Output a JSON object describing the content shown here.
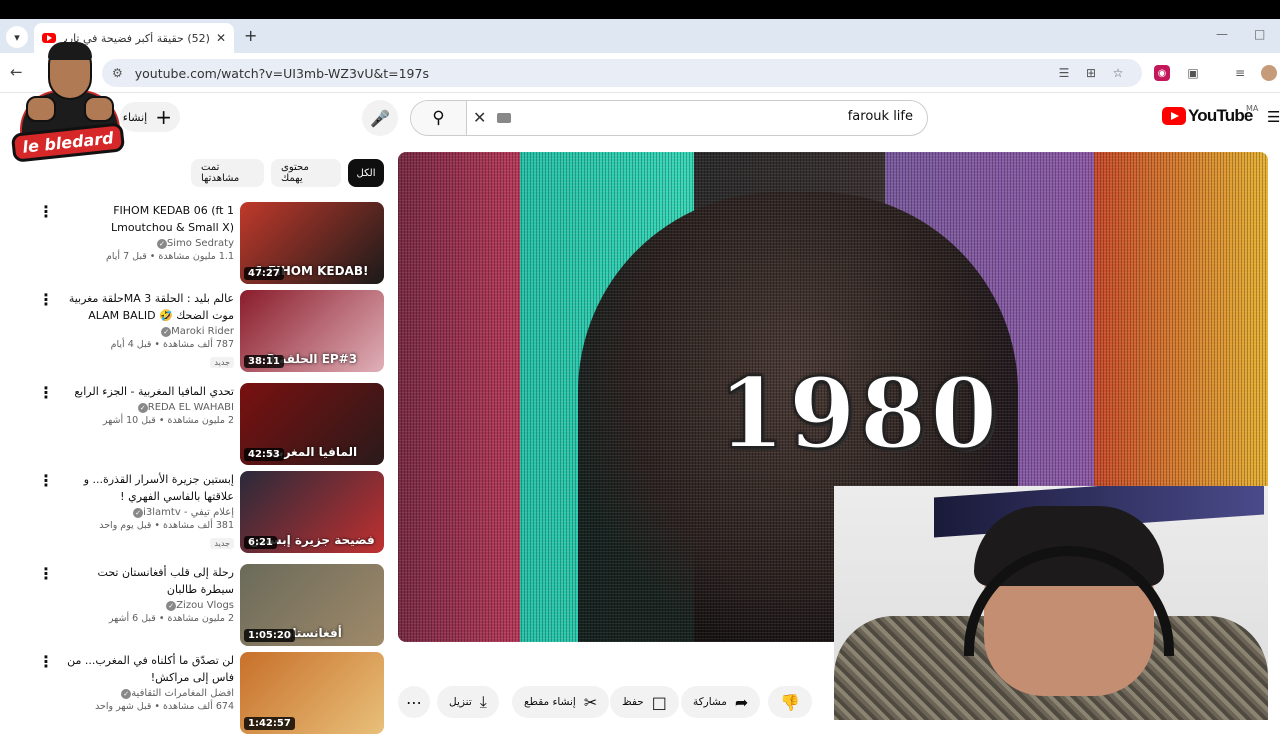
{
  "browser": {
    "tab_title": "(52) حقيقة أكبر فضيحة في تاريخ",
    "url": "youtube.com/watch?v=UI3mb-WZ3vU&t=197s"
  },
  "overlay_logo": {
    "text": "le bledard"
  },
  "header": {
    "create_label": "إنشاء",
    "search_query": "farouk life",
    "logo_text": "YouTube",
    "region": "MA"
  },
  "chips": [
    {
      "label": "الكل"
    },
    {
      "label": "محتوى يهمك"
    },
    {
      "label": "تمت مشاهدتها"
    }
  ],
  "recommendations": [
    {
      "title": "1 FIHOM KEDAB 06 (ft Lmoutchou & Small X)",
      "channel": "Simo Sedraty",
      "verified": true,
      "meta": "1.1 مليون مشاهدة • قبل 7 أيام",
      "duration": "47:27",
      "badge": "",
      "thumb_caption": "1 FIHOM KEDAB!",
      "color_a": "#c0392b",
      "color_b": "#1a1a1a"
    },
    {
      "title": "عالم بليد : الحلقة 3 MAحلقة مغربية موت الضحك 🤣 ALAM BALID EP3 ...",
      "channel": "Maroki Rider",
      "verified": true,
      "meta": "787 ألف مشاهدة • قبل 4 أيام",
      "duration": "38:11",
      "badge": "جديد",
      "thumb_caption": "الحلقة 3 EP#3",
      "color_a": "#8a1c2b",
      "color_b": "#e0b0b8"
    },
    {
      "title": "تحدي المافيا المغربية - الجزء الرابع",
      "channel": "REDA EL WAHABI",
      "verified": true,
      "meta": "2 مليون مشاهدة • قبل 10 أشهر",
      "duration": "42:53",
      "badge": "",
      "thumb_caption": "المافيا المغربية",
      "color_a": "#7a1010",
      "color_b": "#2a1a1a"
    },
    {
      "title": "إبستين جزيرة الأسرار القذرة... و علاقتها بالفاسي الفهري !",
      "channel": "إعلام تيفي - i3lamtv",
      "verified": true,
      "meta": "381 ألف مشاهدة • قبل يوم واحد",
      "duration": "6:21",
      "badge": "جديد",
      "thumb_caption": "فضيحة جزيرة إبستين",
      "color_a": "#2a2a3a",
      "color_b": "#c03030"
    },
    {
      "title": "رحلة إلى قلب أفغانستان تحت سيطرة طالبان",
      "channel": "Zizou Vlogs",
      "verified": true,
      "meta": "2 مليون مشاهدة • قبل 6 أشهر",
      "duration": "1:05:20",
      "badge": "",
      "thumb_caption": "أفغانستان",
      "color_a": "#6a6a5a",
      "color_b": "#a08a6a"
    },
    {
      "title": "لن تصدّق ما أكلناه في المغرب... من فاس إلى مراكش!",
      "channel": "افضل المغامرات الثقافية",
      "verified": true,
      "meta": "674 ألف مشاهدة • قبل شهر واحد",
      "duration": "1:42:57",
      "badge": "",
      "thumb_caption": "",
      "color_a": "#c8702a",
      "color_b": "#e8c07a"
    }
  ],
  "player": {
    "overlay_text": "1980"
  },
  "actions": {
    "download": "تنزيل",
    "clip": "إنشاء مقطع",
    "save": "حفظ",
    "share": "مشاركة"
  },
  "icons": {
    "back": "arrow-left-icon",
    "mic": "mic-icon",
    "search": "search-icon"
  }
}
